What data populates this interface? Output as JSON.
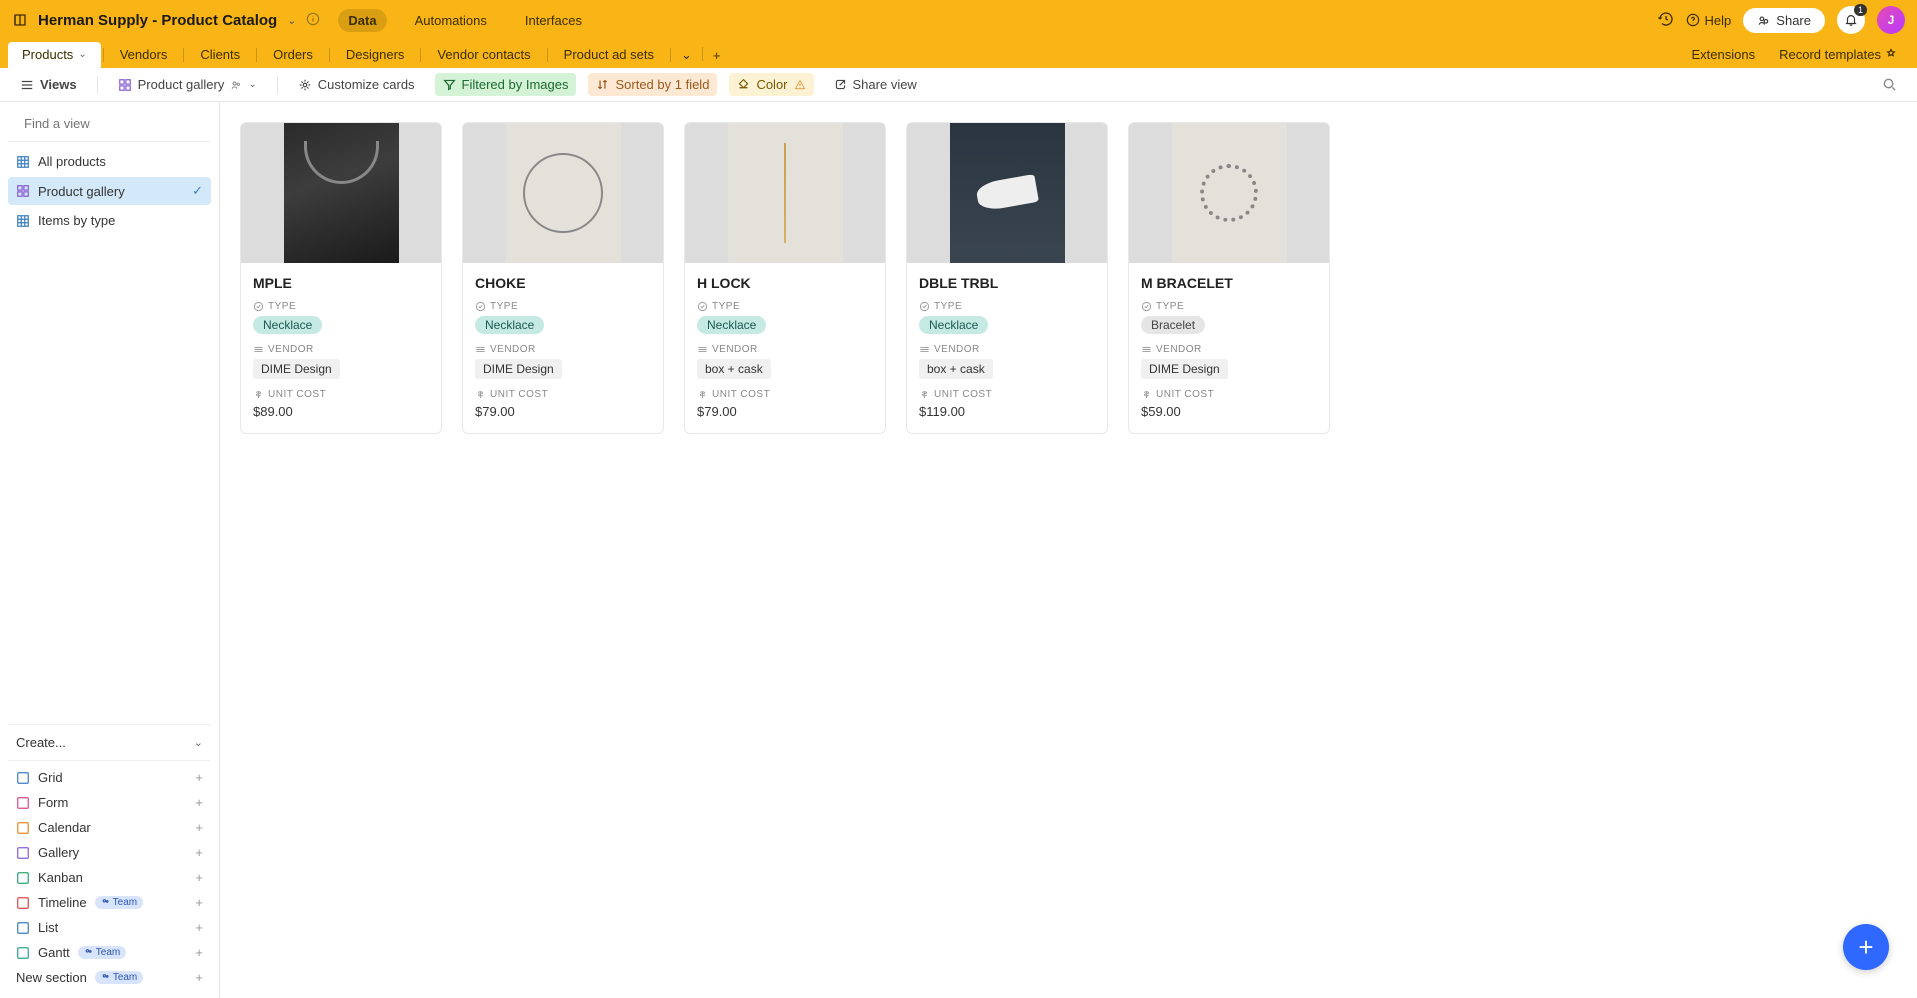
{
  "header": {
    "title": "Herman Supply - Product Catalog",
    "navs": {
      "data": "Data",
      "automations": "Automations",
      "interfaces": "Interfaces"
    },
    "help": "Help",
    "share": "Share",
    "notif_count": "1",
    "avatar_initial": "J"
  },
  "tabs": {
    "items": [
      "Products",
      "Vendors",
      "Clients",
      "Orders",
      "Designers",
      "Vendor contacts",
      "Product ad sets"
    ],
    "right": {
      "extensions": "Extensions",
      "record_templates": "Record templates"
    }
  },
  "toolbar": {
    "views": "Views",
    "view_name": "Product gallery",
    "customize": "Customize cards",
    "filter": "Filtered by Images",
    "sort": "Sorted by 1 field",
    "color": "Color",
    "share_view": "Share view"
  },
  "sidebar": {
    "search_placeholder": "Find a view",
    "views": [
      {
        "label": "All products",
        "icon": "grid",
        "active": false
      },
      {
        "label": "Product gallery",
        "icon": "gallery",
        "active": true
      },
      {
        "label": "Items by type",
        "icon": "grid",
        "active": false
      }
    ],
    "create_label": "Create...",
    "create": [
      {
        "label": "Grid",
        "color": "#3a7ec2"
      },
      {
        "label": "Form",
        "color": "#d94a8c"
      },
      {
        "label": "Calendar",
        "color": "#e28a2b"
      },
      {
        "label": "Gallery",
        "color": "#8a5cd6"
      },
      {
        "label": "Kanban",
        "color": "#2ea36e"
      },
      {
        "label": "Timeline",
        "color": "#d94a4a",
        "team": true
      },
      {
        "label": "List",
        "color": "#3a7ec2"
      },
      {
        "label": "Gantt",
        "color": "#2ea38e",
        "team": true
      }
    ],
    "new_section": "New section",
    "team_badge": "Team"
  },
  "fields": {
    "type": "TYPE",
    "vendor": "VENDOR",
    "unit_cost": "UNIT COST"
  },
  "products": [
    {
      "name": "MPLE",
      "type": "Necklace",
      "type_class": "necklace",
      "vendor": "DIME Design",
      "cost": "$89.00",
      "thumb": "thumb-1"
    },
    {
      "name": "CHOKE",
      "type": "Necklace",
      "type_class": "necklace",
      "vendor": "DIME Design",
      "cost": "$79.00",
      "thumb": "thumb-2"
    },
    {
      "name": "H LOCK",
      "type": "Necklace",
      "type_class": "necklace",
      "vendor": "box + cask",
      "cost": "$79.00",
      "thumb": "thumb-3"
    },
    {
      "name": "DBLE TRBL",
      "type": "Necklace",
      "type_class": "necklace",
      "vendor": "box + cask",
      "cost": "$119.00",
      "thumb": "thumb-4"
    },
    {
      "name": "M BRACELET",
      "type": "Bracelet",
      "type_class": "bracelet",
      "vendor": "DIME Design",
      "cost": "$59.00",
      "thumb": "thumb-5"
    }
  ]
}
